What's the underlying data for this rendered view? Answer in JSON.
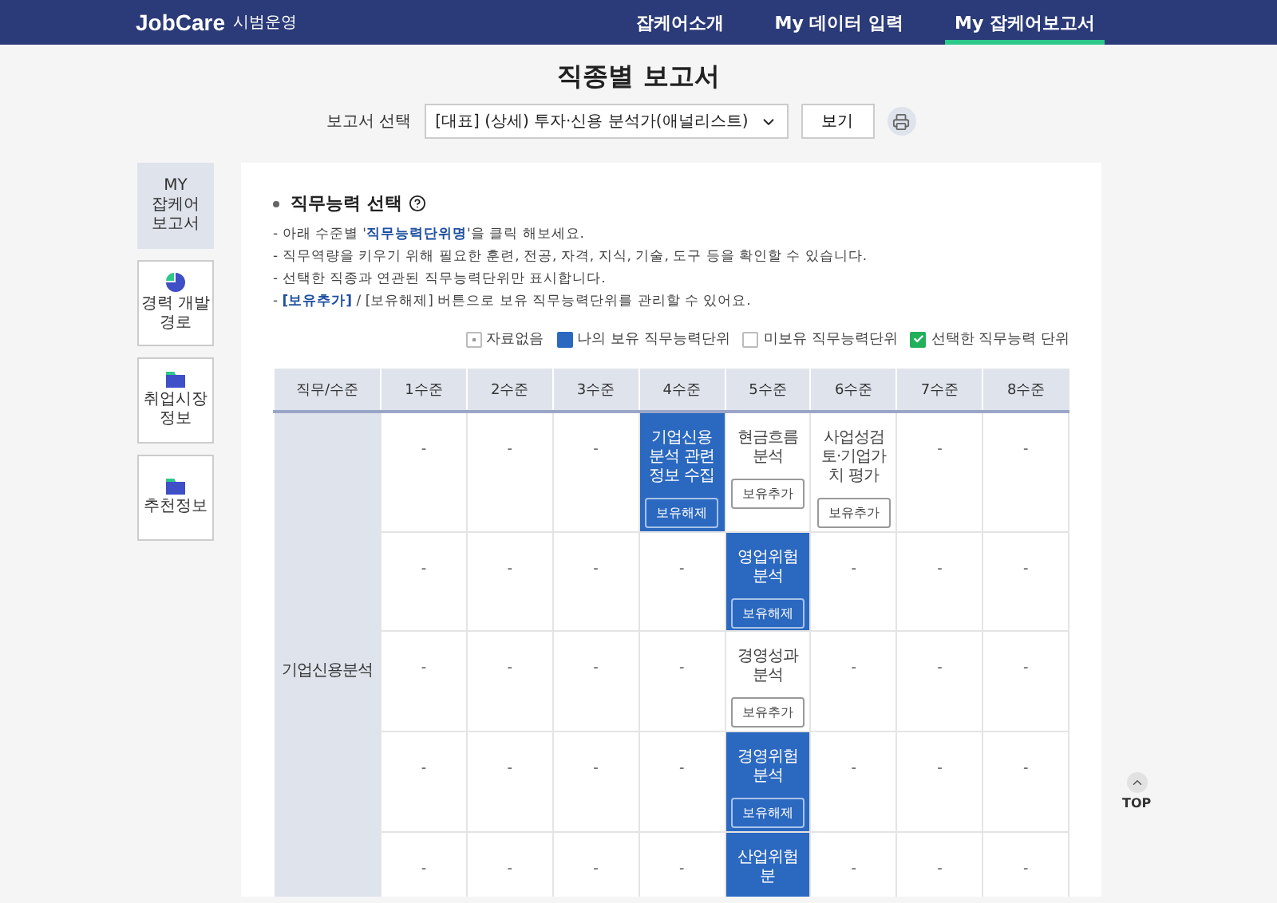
{
  "header": {
    "logo": "JobCare",
    "badge": "시범운영",
    "nav": [
      {
        "label": "잡케어소개",
        "selected": false
      },
      {
        "label": "My 데이터 입력",
        "selected": false
      },
      {
        "label": "My 잡케어보고서",
        "selected": true
      }
    ]
  },
  "page_title": "직종별 보고서",
  "report_select": {
    "label": "보고서 선택",
    "value": "[대표] (상세) 투자·신용 분석가(애널리스트)",
    "button": "보기"
  },
  "sidebar": {
    "items": [
      {
        "label": "MY\n잡케어\n보고서",
        "kind": "text",
        "selected": true
      },
      {
        "label": "경력 개발\n경로",
        "kind": "chart",
        "selected": false
      },
      {
        "label": "취업시장\n정보",
        "kind": "info",
        "selected": false
      },
      {
        "label": "추천정보",
        "kind": "info",
        "selected": false
      }
    ]
  },
  "section": {
    "title": "직무능력 선택",
    "notes": [
      "- 아래 수준별 '**직무능력단위명**'을 클릭 해보세요.",
      "- 직무역량을 키우기 위해 필요한 훈련, 전공, 자격, 지식, 기술, 도구 등을 확인할 수 있습니다.",
      "- 선택한 직종과 연관된 직무능력단위만 표시합니다.",
      "- **[보유추가]** / [보유해제] 버튼으로 보유 직무능력단위를 관리할 수 있어요."
    ]
  },
  "legend": [
    {
      "kind": "none",
      "label": "자료없음"
    },
    {
      "kind": "owned",
      "label": "나의 보유 직무능력단위"
    },
    {
      "kind": "unowned",
      "label": "미보유 직무능력단위"
    },
    {
      "kind": "selected",
      "label": "선택한 직무능력 단위"
    }
  ],
  "table": {
    "columns": [
      "직무/수준",
      "1수준",
      "2수준",
      "3수준",
      "4수준",
      "5수준",
      "6수준",
      "7수준",
      "8수준"
    ],
    "rows": [
      {
        "cells": [
          {
            "kind": "group",
            "text": "기업신용분석",
            "rowspan": 5
          },
          {
            "kind": "empty",
            "text": "-"
          },
          {
            "kind": "empty",
            "text": "-"
          },
          {
            "kind": "empty",
            "text": "-"
          },
          {
            "kind": "unit",
            "text": "기업신용분석 관련 정보 수집",
            "owned": true,
            "button": "보유해제"
          },
          {
            "kind": "unit",
            "text": "현금흐름분석",
            "owned": false,
            "button": "보유추가"
          },
          {
            "kind": "unit",
            "text": "사업성검토·기업가치 평가",
            "owned": false,
            "button": "보유추가"
          },
          {
            "kind": "empty",
            "text": "-"
          },
          {
            "kind": "empty",
            "text": "-"
          }
        ]
      },
      {
        "cells": [
          {
            "kind": "empty",
            "text": "-"
          },
          {
            "kind": "empty",
            "text": "-"
          },
          {
            "kind": "empty",
            "text": "-"
          },
          {
            "kind": "empty",
            "text": "-"
          },
          {
            "kind": "unit",
            "text": "영업위험 분석",
            "owned": true,
            "button": "보유해제"
          },
          {
            "kind": "empty",
            "text": "-"
          },
          {
            "kind": "empty",
            "text": "-"
          },
          {
            "kind": "empty",
            "text": "-"
          }
        ]
      },
      {
        "cells": [
          {
            "kind": "empty",
            "text": "-"
          },
          {
            "kind": "empty",
            "text": "-"
          },
          {
            "kind": "empty",
            "text": "-"
          },
          {
            "kind": "empty",
            "text": "-"
          },
          {
            "kind": "unit",
            "text": "경영성과 분석",
            "owned": false,
            "button": "보유추가"
          },
          {
            "kind": "empty",
            "text": "-"
          },
          {
            "kind": "empty",
            "text": "-"
          },
          {
            "kind": "empty",
            "text": "-"
          }
        ]
      },
      {
        "cells": [
          {
            "kind": "empty",
            "text": "-"
          },
          {
            "kind": "empty",
            "text": "-"
          },
          {
            "kind": "empty",
            "text": "-"
          },
          {
            "kind": "empty",
            "text": "-"
          },
          {
            "kind": "unit",
            "text": "경영위험 분석",
            "owned": true,
            "button": "보유해제"
          },
          {
            "kind": "empty",
            "text": "-"
          },
          {
            "kind": "empty",
            "text": "-"
          },
          {
            "kind": "empty",
            "text": "-"
          }
        ]
      },
      {
        "cells": [
          {
            "kind": "empty",
            "text": "-"
          },
          {
            "kind": "empty",
            "text": "-"
          },
          {
            "kind": "empty",
            "text": "-"
          },
          {
            "kind": "empty",
            "text": "-"
          },
          {
            "kind": "unit",
            "text": "산업위험 분",
            "owned": true
          },
          {
            "kind": "empty",
            "text": "-"
          },
          {
            "kind": "empty",
            "text": "-"
          },
          {
            "kind": "empty",
            "text": "-"
          }
        ]
      }
    ]
  },
  "top_button": "TOP"
}
